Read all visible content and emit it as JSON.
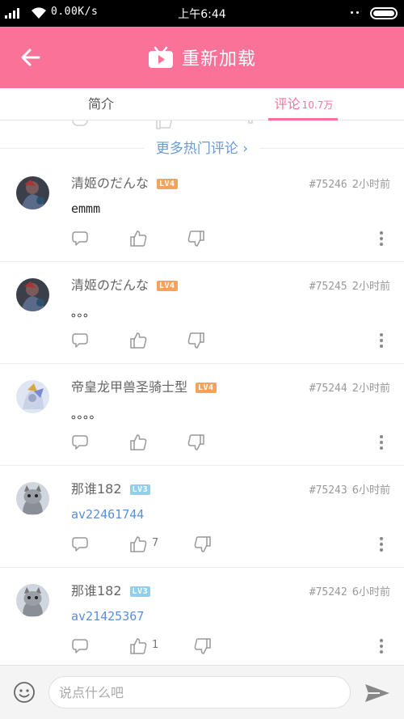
{
  "status_bar": {
    "speed": "0.00K/s",
    "time": "上午6:44"
  },
  "header": {
    "title": "重新加载"
  },
  "tabs": {
    "intro": "简介",
    "comments": "评论",
    "comments_count": "10.7万"
  },
  "more_hot": "更多热门评论 ›",
  "comments": [
    {
      "user": "清姬のだんな",
      "level": "LV4",
      "floor": "#75246",
      "time": "2小时前",
      "text": "emmm",
      "likes": ""
    },
    {
      "user": "清姬のだんな",
      "level": "LV4",
      "floor": "#75245",
      "time": "2小时前",
      "text": "。。。",
      "likes": ""
    },
    {
      "user": "帝皇龙甲兽圣骑士型",
      "level": "LV4",
      "floor": "#75244",
      "time": "2小时前",
      "text": "。。。。",
      "likes": ""
    },
    {
      "user": "那谁182",
      "level": "LV3",
      "floor": "#75243",
      "time": "6小时前",
      "text": "av22461744",
      "likes": "7"
    },
    {
      "user": "那谁182",
      "level": "LV3",
      "floor": "#75242",
      "time": "6小时前",
      "text": "av21425367",
      "likes": "1"
    }
  ],
  "input": {
    "placeholder": "说点什么吧",
    "value": ""
  },
  "colors": {
    "accent": "#fb7299",
    "link": "#5a8fd6",
    "lv4": "#f5a35c",
    "lv3": "#8fd0ea"
  },
  "icons": [
    "back-arrow-icon",
    "tv-icon",
    "reply-icon",
    "thumb-up-icon",
    "thumb-down-icon",
    "more-vertical-icon",
    "emoji-icon",
    "send-icon"
  ]
}
